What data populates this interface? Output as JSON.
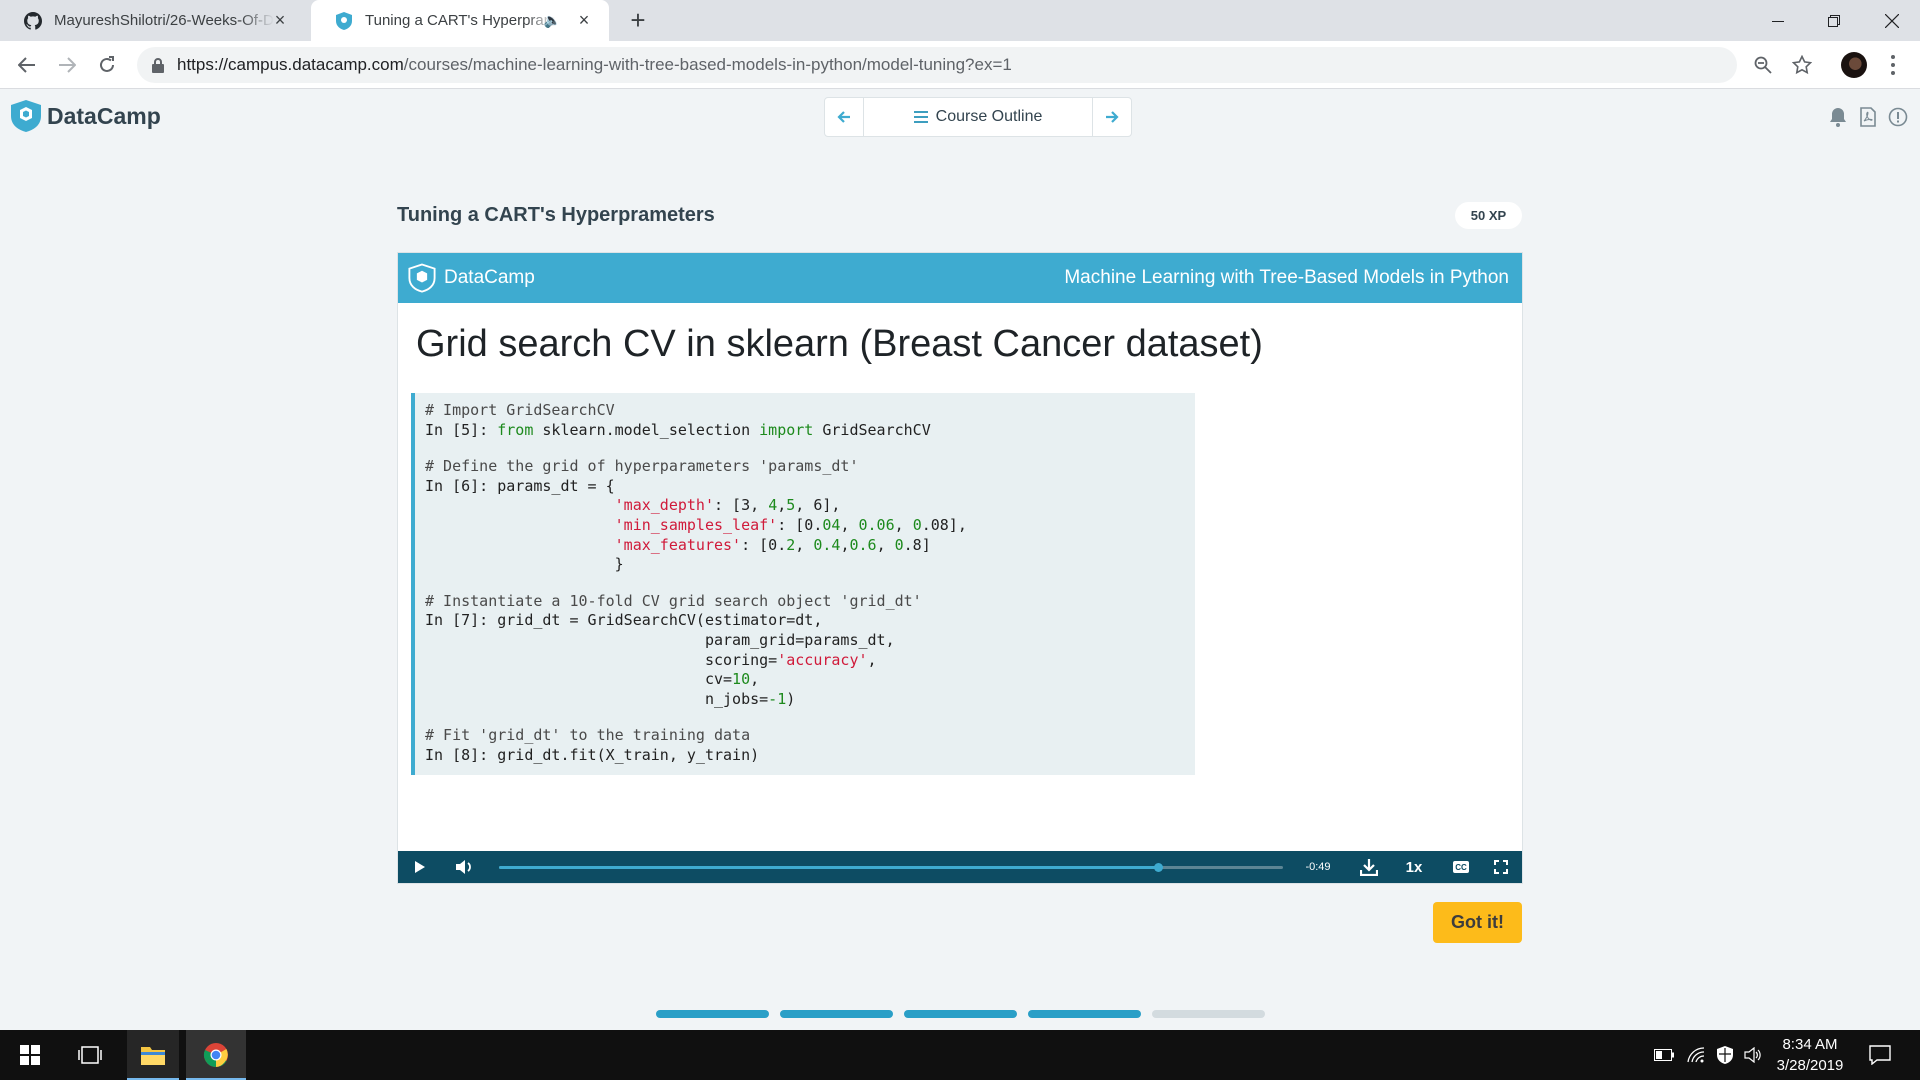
{
  "browser": {
    "tabs": [
      {
        "title": "MayureshShilotri/26-Weeks-Of-D",
        "active": false
      },
      {
        "title": "Tuning a CART's Hyperprame",
        "active": true
      }
    ],
    "url_host": "https://campus.datacamp.com",
    "url_path": "/courses/machine-learning-with-tree-based-models-in-python/model-tuning?ex=1"
  },
  "header": {
    "logo_text": "DataCamp",
    "course_outline_label": "Course Outline"
  },
  "exercise": {
    "title": "Tuning a CART's Hyperprameters",
    "xp": "50 XP",
    "got_it_label": "Got it!"
  },
  "video": {
    "brand": "DataCamp",
    "course_title": "Machine Learning with Tree-Based Models in Python",
    "slide_title": "Grid search CV in sklearn (Breast Cancer dataset)",
    "code_lines": [
      "# Import GridSearchCV",
      "In [5]: from sklearn.model_selection import GridSearchCV",
      "",
      "# Define the grid of hyperparameters 'params_dt'",
      "In [6]: params_dt = {",
      "                     'max_depth': [3, 4,5, 6],",
      "                     'min_samples_leaf': [0.04, 0.06, 0.08],",
      "                     'max_features': [0.2, 0.4,0.6, 0.8]",
      "                     }",
      "",
      "# Instantiate a 10-fold CV grid search object 'grid_dt'",
      "In [7]: grid_dt = GridSearchCV(estimator=dt,",
      "                               param_grid=params_dt,",
      "                               scoring='accuracy',",
      "                               cv=10,",
      "                               n_jobs=-1)",
      "",
      "# Fit 'grid_dt' to the training data",
      "In [8]: grid_dt.fit(X_train, y_train)"
    ],
    "time_remaining": "-0:49",
    "speed": "1x",
    "played_fraction": 0.84
  },
  "progress_segments": [
    {
      "state": "done"
    },
    {
      "state": "done"
    },
    {
      "state": "done"
    },
    {
      "state": "done"
    },
    {
      "state": "pending"
    }
  ],
  "taskbar": {
    "time": "8:34 AM",
    "date": "3/28/2019"
  },
  "colors": {
    "accent": "#3eabd0",
    "controls_bg": "#0d4c63",
    "got_it": "#fdbb1a",
    "progress_done": "#2a9fc7",
    "progress_pending": "#d3dbdf"
  }
}
